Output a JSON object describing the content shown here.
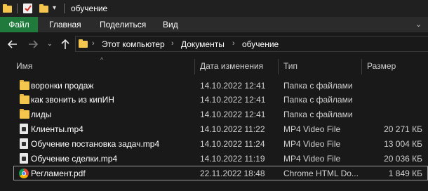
{
  "window": {
    "title": "обучение"
  },
  "ribbon": {
    "tabs": [
      {
        "label": "Файл"
      },
      {
        "label": "Главная"
      },
      {
        "label": "Поделиться"
      },
      {
        "label": "Вид"
      }
    ],
    "file_tab_color": "#1f7a3c"
  },
  "address": {
    "crumbs": [
      "Этот компьютер",
      "Документы",
      "обучение"
    ]
  },
  "columns": {
    "name": "Имя",
    "date": "Дата изменения",
    "type": "Тип",
    "size": "Размер"
  },
  "files": [
    {
      "name": "воронки продаж",
      "date": "14.10.2022 12:41",
      "type": "Папка с файлами",
      "size": "",
      "icon": "folder-icon"
    },
    {
      "name": "как звонить из кипИН",
      "date": "14.10.2022 12:41",
      "type": "Папка с файлами",
      "size": "",
      "icon": "folder-icon"
    },
    {
      "name": "лиды",
      "date": "14.10.2022 12:41",
      "type": "Папка с файлами",
      "size": "",
      "icon": "folder-icon"
    },
    {
      "name": "Клиенты.mp4",
      "date": "14.10.2022 11:22",
      "type": "MP4 Video File",
      "size": "20 271 КБ",
      "icon": "video-file-icon"
    },
    {
      "name": "Обучение постановка задач.mp4",
      "date": "14.10.2022 11:24",
      "type": "MP4 Video File",
      "size": "13 004 КБ",
      "icon": "video-file-icon"
    },
    {
      "name": "Обучение сделки.mp4",
      "date": "14.10.2022 11:19",
      "type": "MP4 Video File",
      "size": "20 036 КБ",
      "icon": "video-file-icon"
    },
    {
      "name": "Регламент.pdf",
      "date": "22.11.2022 18:48",
      "type": "Chrome HTML Do...",
      "size": "1 849 КБ",
      "icon": "chrome-icon"
    }
  ]
}
